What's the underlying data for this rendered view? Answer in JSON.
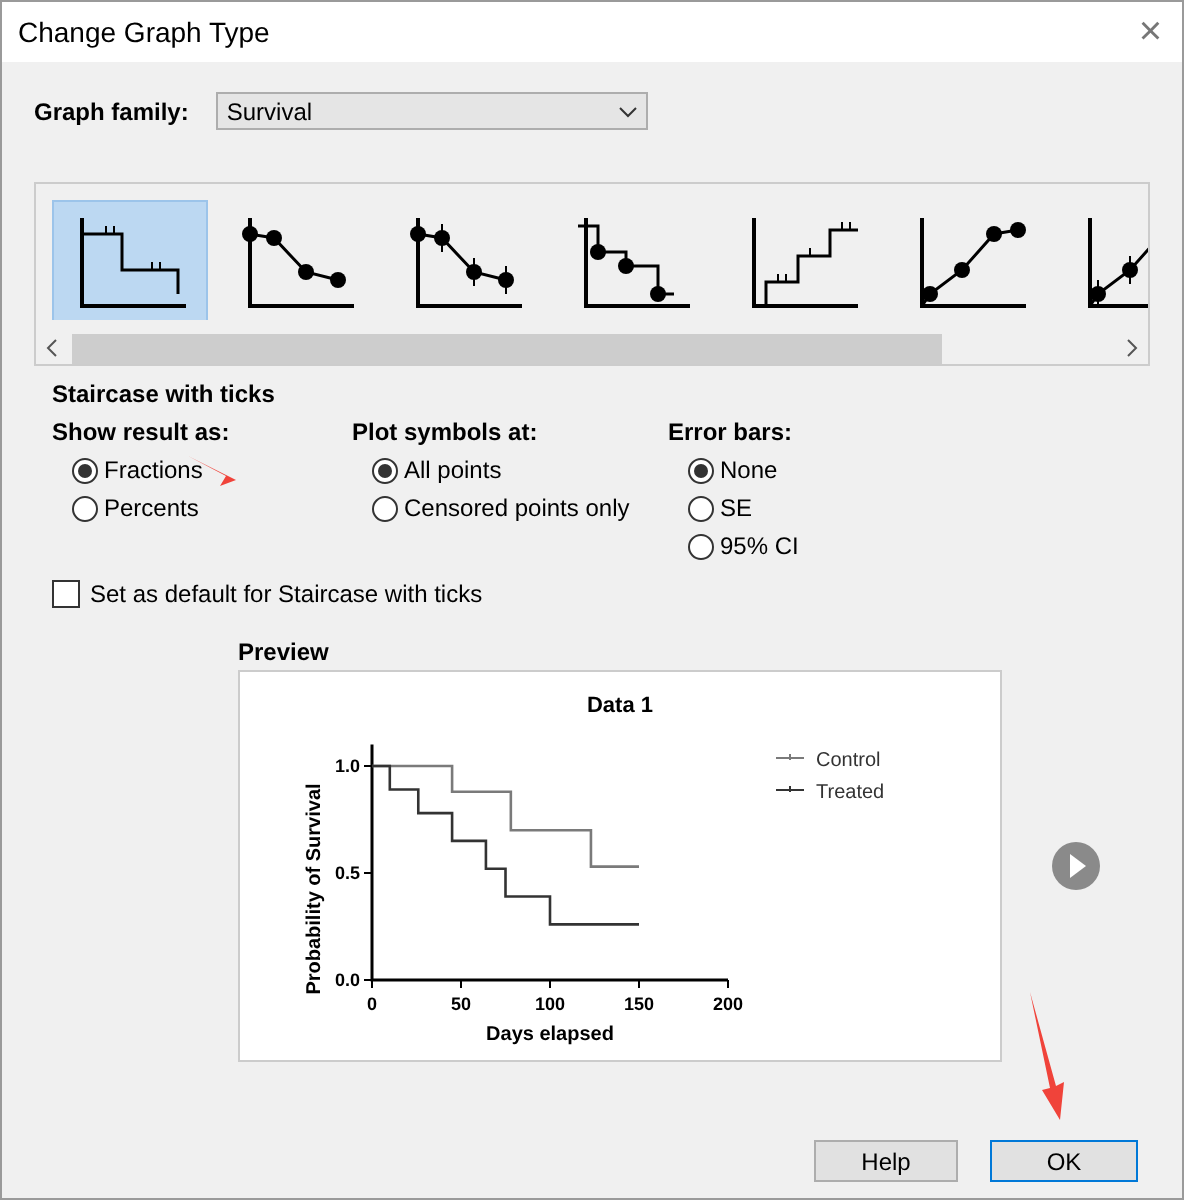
{
  "window": {
    "title": "Change Graph Type",
    "close": "×"
  },
  "graph_family": {
    "label": "Graph family:",
    "value": "Survival"
  },
  "gallery": [
    {
      "kind": "staircase-ticks",
      "selected": true
    },
    {
      "kind": "points-line",
      "selected": false
    },
    {
      "kind": "points-errorbars",
      "selected": false
    },
    {
      "kind": "staircase-points",
      "selected": false
    },
    {
      "kind": "staircase-up",
      "selected": false
    },
    {
      "kind": "points-line-up",
      "selected": false
    },
    {
      "kind": "points-errorbars-up",
      "selected": false
    }
  ],
  "section_title": "Staircase with ticks",
  "option_groups": [
    {
      "label": "Show result as:",
      "options": [
        {
          "label": "Fractions",
          "selected": true
        },
        {
          "label": "Percents",
          "selected": false
        }
      ]
    },
    {
      "label": "Plot symbols at:",
      "options": [
        {
          "label": "All points",
          "selected": true
        },
        {
          "label": "Censored points only",
          "selected": false
        }
      ]
    },
    {
      "label": "Error bars:",
      "options": [
        {
          "label": "None",
          "selected": true
        },
        {
          "label": "SE",
          "selected": false
        },
        {
          "label": "95% CI",
          "selected": false
        }
      ]
    }
  ],
  "default_checkbox": {
    "label": "Set as default for Staircase with ticks",
    "checked": false
  },
  "preview": {
    "label": "Preview",
    "chart_data": {
      "type": "line",
      "title": "Data 1",
      "xlabel": "Days elapsed",
      "ylabel": "Probability of Survival",
      "x": [
        0,
        10,
        10,
        26,
        26,
        45,
        45,
        64,
        64,
        75,
        75,
        78,
        78,
        100,
        100,
        123,
        123,
        150
      ],
      "series": [
        {
          "name": "Control",
          "color": "#7a7a7a",
          "values": [
            1,
            1,
            1,
            1,
            1,
            1,
            0.88,
            0.88,
            0.88,
            0.88,
            0.88,
            0.88,
            0.7,
            0.7,
            0.7,
            0.7,
            0.53,
            0.53
          ]
        },
        {
          "name": "Treated",
          "color": "#333333",
          "values": [
            1,
            1,
            0.89,
            0.89,
            0.78,
            0.78,
            0.65,
            0.65,
            0.52,
            0.52,
            0.39,
            0.39,
            0.39,
            0.39,
            0.26,
            0.26,
            0.26,
            0.26
          ]
        }
      ],
      "legend": true,
      "xlim": [
        0,
        200
      ],
      "ylim": [
        0,
        1.1
      ],
      "xticks": [
        0,
        50,
        100,
        150,
        200
      ],
      "yticks": [
        {
          "value": 0,
          "label": "0.0"
        },
        {
          "value": 0.5,
          "label": "0.5"
        },
        {
          "value": 1,
          "label": "1.0"
        }
      ]
    }
  },
  "buttons": [
    {
      "label": "Help",
      "default": false
    },
    {
      "label": "OK",
      "default": true
    }
  ]
}
